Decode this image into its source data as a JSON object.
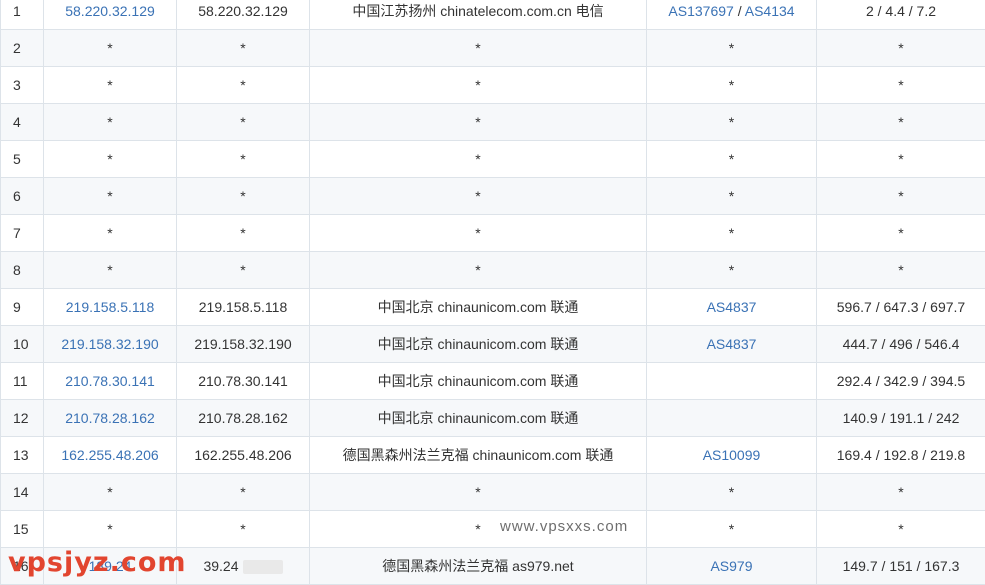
{
  "rows": [
    {
      "hop": "1",
      "ip_link": "58.220.32.129",
      "ip": "58.220.32.129",
      "location": "中国江苏扬州 chinatelecom.com.cn 电信",
      "asn": [
        "AS137697",
        "AS4134"
      ],
      "latency": "2 / 4.4 / 7.2"
    },
    {
      "hop": "2",
      "ip_link": "*",
      "ip": "*",
      "location": "*",
      "asn": [
        "*"
      ],
      "latency": "*"
    },
    {
      "hop": "3",
      "ip_link": "*",
      "ip": "*",
      "location": "*",
      "asn": [
        "*"
      ],
      "latency": "*"
    },
    {
      "hop": "4",
      "ip_link": "*",
      "ip": "*",
      "location": "*",
      "asn": [
        "*"
      ],
      "latency": "*"
    },
    {
      "hop": "5",
      "ip_link": "*",
      "ip": "*",
      "location": "*",
      "asn": [
        "*"
      ],
      "latency": "*"
    },
    {
      "hop": "6",
      "ip_link": "*",
      "ip": "*",
      "location": "*",
      "asn": [
        "*"
      ],
      "latency": "*"
    },
    {
      "hop": "7",
      "ip_link": "*",
      "ip": "*",
      "location": "*",
      "asn": [
        "*"
      ],
      "latency": "*"
    },
    {
      "hop": "8",
      "ip_link": "*",
      "ip": "*",
      "location": "*",
      "asn": [
        "*"
      ],
      "latency": "*"
    },
    {
      "hop": "9",
      "ip_link": "219.158.5.118",
      "ip": "219.158.5.118",
      "location": "中国北京 chinaunicom.com 联通",
      "asn": [
        "AS4837"
      ],
      "latency": "596.7 / 647.3 / 697.7"
    },
    {
      "hop": "10",
      "ip_link": "219.158.32.190",
      "ip": "219.158.32.190",
      "location": "中国北京 chinaunicom.com 联通",
      "asn": [
        "AS4837"
      ],
      "latency": "444.7 / 496 / 546.4"
    },
    {
      "hop": "11",
      "ip_link": "210.78.30.141",
      "ip": "210.78.30.141",
      "location": "中国北京 chinaunicom.com 联通",
      "asn": [],
      "latency": "292.4 / 342.9 / 394.5"
    },
    {
      "hop": "12",
      "ip_link": "210.78.28.162",
      "ip": "210.78.28.162",
      "location": "中国北京 chinaunicom.com 联通",
      "asn": [],
      "latency": "140.9 / 191.1 / 242"
    },
    {
      "hop": "13",
      "ip_link": "162.255.48.206",
      "ip": "162.255.48.206",
      "location": "德国黑森州法兰克福 chinaunicom.com 联通",
      "asn": [
        "AS10099"
      ],
      "latency": "169.4 / 192.8 / 219.8"
    },
    {
      "hop": "14",
      "ip_link": "*",
      "ip": "*",
      "location": "*",
      "asn": [
        "*"
      ],
      "latency": "*"
    },
    {
      "hop": "15",
      "ip_link": "*",
      "ip": "*",
      "location": "*",
      "asn": [
        "*"
      ],
      "latency": "*"
    },
    {
      "hop": "16",
      "ip_link": "189.24",
      "ip": "39.24",
      "location": "德国黑森州法兰克福 as979.net",
      "asn": [
        "AS979"
      ],
      "latency": "149.7 / 151 / 167.3"
    }
  ],
  "asn_separator": " / ",
  "watermarks": {
    "center": "www.vpsxxs.com",
    "corner": "vpsjyz.com"
  },
  "colors": {
    "link": "#3a72b5",
    "border": "#dde3e9",
    "stripe": "#f6f8fa",
    "corner_watermark": "#e2452f"
  }
}
